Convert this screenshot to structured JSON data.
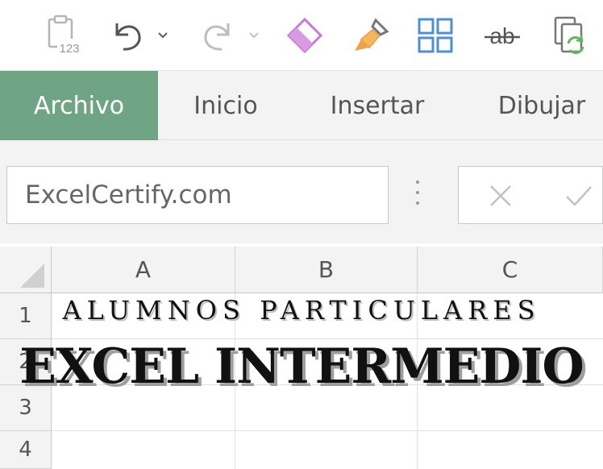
{
  "toolbar": {
    "icons": [
      "paste-values-icon",
      "undo-icon",
      "undo-dropdown-icon",
      "redo-icon",
      "redo-dropdown-icon",
      "eraser-icon",
      "format-painter-icon",
      "grid-layout-icon",
      "strikethrough-icon",
      "refresh-copy-icon"
    ],
    "paste_badge": "123",
    "strikethrough_text": "ab"
  },
  "tabs": [
    {
      "label": "Archivo",
      "active": true
    },
    {
      "label": "Inicio",
      "active": false
    },
    {
      "label": "Insertar",
      "active": false
    },
    {
      "label": "Dibujar",
      "active": false
    }
  ],
  "formula_bar": {
    "name_box_value": "ExcelCertify.com",
    "icons": [
      "more-options-icon",
      "cancel-x-icon",
      "confirm-check-icon"
    ]
  },
  "grid": {
    "columns": [
      "A",
      "B",
      "C"
    ],
    "rows": [
      "1",
      "2",
      "3",
      "4"
    ]
  },
  "overlay": {
    "subtitle": "ALUMNOS PARTICULARES",
    "title": "EXCEL INTERMEDIO"
  },
  "colors": {
    "active_tab": "#6fa585",
    "ribbon_bg": "#f3f3f3",
    "eraser": "#c77ad6",
    "brush": "#f0a24a",
    "grid_icon": "#4f8fd0",
    "refresh": "#5cb85c"
  }
}
